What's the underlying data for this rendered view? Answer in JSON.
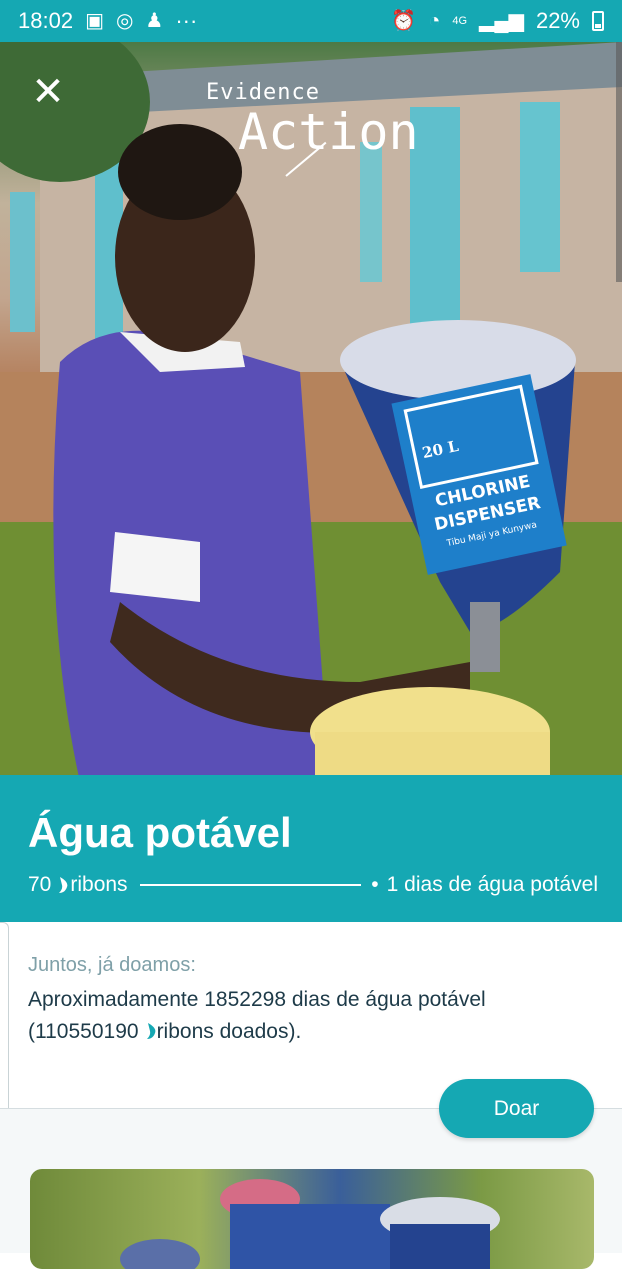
{
  "status_bar": {
    "time": "18:02",
    "more": "···",
    "network": "4G",
    "battery": "22%",
    "icons": [
      "gallery-icon",
      "whatsapp-icon",
      "notification-icon",
      "alarm-icon",
      "wifi-icon",
      "signal-icon",
      "battery-icon"
    ]
  },
  "hero": {
    "close_glyph": "✕",
    "logo_small": "Evidence",
    "logo_big": "Action",
    "dispenser_l1": "CHLORINE",
    "dispenser_l2": "DISPENSER",
    "dispenser_sub": "Tibu Maji ya Kunywa",
    "dispenser_vol": "20 L"
  },
  "project": {
    "title": "Água potável",
    "amount": "70",
    "unit": "ribons",
    "dot": "•",
    "result": "1 dias de água potável"
  },
  "together": {
    "label": "Juntos, já doamos:",
    "line1": "Aproximadamente 1852298 dias de água potável",
    "open": "(110550190",
    "close": "ribons doados)."
  },
  "actions": {
    "donate": "Doar"
  },
  "colors": {
    "accent": "#15a8b3",
    "text_dark": "#1e3b49",
    "muted": "#7fa0a8"
  }
}
